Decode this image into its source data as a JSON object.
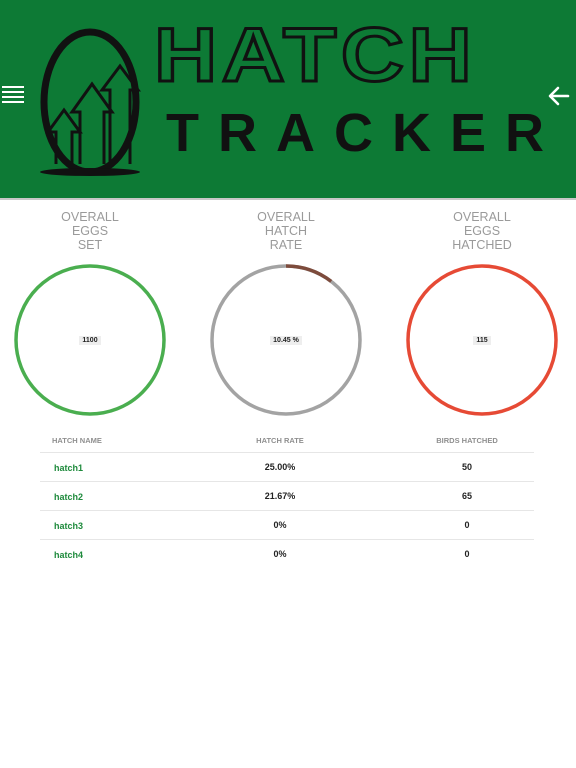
{
  "header": {
    "logo_title": "HATCH",
    "logo_subtitle": "TRACKER",
    "menu_icon": "hamburger-menu-icon",
    "back_icon": "arrow-left-icon",
    "background_color": "#0d7a35"
  },
  "stats": [
    {
      "label_line1": "OVERALL",
      "label_line2": "EGGS",
      "label_line3": "SET",
      "value": "1100",
      "color": "#4aae4f",
      "ring_fraction": 1.0
    },
    {
      "label_line1": "OVERALL",
      "label_line2": "HATCH",
      "label_line3": "RATE",
      "value": "10.45 %",
      "color": "#a3a3a3",
      "progress_color": "#7d4b3c",
      "progress_fraction": 0.1045
    },
    {
      "label_line1": "OVERALL",
      "label_line2": "EGGS",
      "label_line3": "HATCHED",
      "value": "115",
      "color": "#e64a35",
      "ring_fraction": 1.0
    }
  ],
  "table": {
    "headers": {
      "name": "HATCH NAME",
      "rate": "HATCH RATE",
      "birds": "BIRDS HATCHED"
    },
    "rows": [
      {
        "name": "hatch1",
        "rate": "25.00%",
        "birds": "50"
      },
      {
        "name": "hatch2",
        "rate": "21.67%",
        "birds": "65"
      },
      {
        "name": "hatch3",
        "rate": "0%",
        "birds": "0"
      },
      {
        "name": "hatch4",
        "rate": "0%",
        "birds": "0"
      }
    ]
  }
}
